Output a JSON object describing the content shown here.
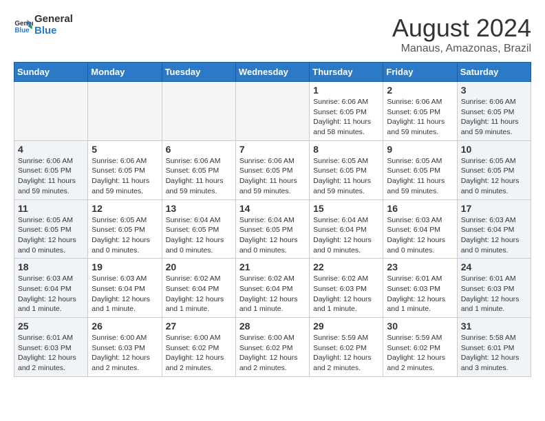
{
  "header": {
    "logo_line1": "General",
    "logo_line2": "Blue",
    "month_year": "August 2024",
    "location": "Manaus, Amazonas, Brazil"
  },
  "weekdays": [
    "Sunday",
    "Monday",
    "Tuesday",
    "Wednesday",
    "Thursday",
    "Friday",
    "Saturday"
  ],
  "weeks": [
    [
      {
        "day": "",
        "info": "",
        "empty": true
      },
      {
        "day": "",
        "info": "",
        "empty": true
      },
      {
        "day": "",
        "info": "",
        "empty": true
      },
      {
        "day": "",
        "info": "",
        "empty": true
      },
      {
        "day": "1",
        "info": "Sunrise: 6:06 AM\nSunset: 6:05 PM\nDaylight: 11 hours\nand 58 minutes.",
        "empty": false
      },
      {
        "day": "2",
        "info": "Sunrise: 6:06 AM\nSunset: 6:05 PM\nDaylight: 11 hours\nand 59 minutes.",
        "empty": false
      },
      {
        "day": "3",
        "info": "Sunrise: 6:06 AM\nSunset: 6:05 PM\nDaylight: 11 hours\nand 59 minutes.",
        "empty": false
      }
    ],
    [
      {
        "day": "4",
        "info": "Sunrise: 6:06 AM\nSunset: 6:05 PM\nDaylight: 11 hours\nand 59 minutes.",
        "empty": false
      },
      {
        "day": "5",
        "info": "Sunrise: 6:06 AM\nSunset: 6:05 PM\nDaylight: 11 hours\nand 59 minutes.",
        "empty": false
      },
      {
        "day": "6",
        "info": "Sunrise: 6:06 AM\nSunset: 6:05 PM\nDaylight: 11 hours\nand 59 minutes.",
        "empty": false
      },
      {
        "day": "7",
        "info": "Sunrise: 6:06 AM\nSunset: 6:05 PM\nDaylight: 11 hours\nand 59 minutes.",
        "empty": false
      },
      {
        "day": "8",
        "info": "Sunrise: 6:05 AM\nSunset: 6:05 PM\nDaylight: 11 hours\nand 59 minutes.",
        "empty": false
      },
      {
        "day": "9",
        "info": "Sunrise: 6:05 AM\nSunset: 6:05 PM\nDaylight: 11 hours\nand 59 minutes.",
        "empty": false
      },
      {
        "day": "10",
        "info": "Sunrise: 6:05 AM\nSunset: 6:05 PM\nDaylight: 12 hours\nand 0 minutes.",
        "empty": false
      }
    ],
    [
      {
        "day": "11",
        "info": "Sunrise: 6:05 AM\nSunset: 6:05 PM\nDaylight: 12 hours\nand 0 minutes.",
        "empty": false
      },
      {
        "day": "12",
        "info": "Sunrise: 6:05 AM\nSunset: 6:05 PM\nDaylight: 12 hours\nand 0 minutes.",
        "empty": false
      },
      {
        "day": "13",
        "info": "Sunrise: 6:04 AM\nSunset: 6:05 PM\nDaylight: 12 hours\nand 0 minutes.",
        "empty": false
      },
      {
        "day": "14",
        "info": "Sunrise: 6:04 AM\nSunset: 6:05 PM\nDaylight: 12 hours\nand 0 minutes.",
        "empty": false
      },
      {
        "day": "15",
        "info": "Sunrise: 6:04 AM\nSunset: 6:04 PM\nDaylight: 12 hours\nand 0 minutes.",
        "empty": false
      },
      {
        "day": "16",
        "info": "Sunrise: 6:03 AM\nSunset: 6:04 PM\nDaylight: 12 hours\nand 0 minutes.",
        "empty": false
      },
      {
        "day": "17",
        "info": "Sunrise: 6:03 AM\nSunset: 6:04 PM\nDaylight: 12 hours\nand 0 minutes.",
        "empty": false
      }
    ],
    [
      {
        "day": "18",
        "info": "Sunrise: 6:03 AM\nSunset: 6:04 PM\nDaylight: 12 hours\nand 1 minute.",
        "empty": false
      },
      {
        "day": "19",
        "info": "Sunrise: 6:03 AM\nSunset: 6:04 PM\nDaylight: 12 hours\nand 1 minute.",
        "empty": false
      },
      {
        "day": "20",
        "info": "Sunrise: 6:02 AM\nSunset: 6:04 PM\nDaylight: 12 hours\nand 1 minute.",
        "empty": false
      },
      {
        "day": "21",
        "info": "Sunrise: 6:02 AM\nSunset: 6:04 PM\nDaylight: 12 hours\nand 1 minute.",
        "empty": false
      },
      {
        "day": "22",
        "info": "Sunrise: 6:02 AM\nSunset: 6:03 PM\nDaylight: 12 hours\nand 1 minute.",
        "empty": false
      },
      {
        "day": "23",
        "info": "Sunrise: 6:01 AM\nSunset: 6:03 PM\nDaylight: 12 hours\nand 1 minute.",
        "empty": false
      },
      {
        "day": "24",
        "info": "Sunrise: 6:01 AM\nSunset: 6:03 PM\nDaylight: 12 hours\nand 1 minute.",
        "empty": false
      }
    ],
    [
      {
        "day": "25",
        "info": "Sunrise: 6:01 AM\nSunset: 6:03 PM\nDaylight: 12 hours\nand 2 minutes.",
        "empty": false
      },
      {
        "day": "26",
        "info": "Sunrise: 6:00 AM\nSunset: 6:03 PM\nDaylight: 12 hours\nand 2 minutes.",
        "empty": false
      },
      {
        "day": "27",
        "info": "Sunrise: 6:00 AM\nSunset: 6:02 PM\nDaylight: 12 hours\nand 2 minutes.",
        "empty": false
      },
      {
        "day": "28",
        "info": "Sunrise: 6:00 AM\nSunset: 6:02 PM\nDaylight: 12 hours\nand 2 minutes.",
        "empty": false
      },
      {
        "day": "29",
        "info": "Sunrise: 5:59 AM\nSunset: 6:02 PM\nDaylight: 12 hours\nand 2 minutes.",
        "empty": false
      },
      {
        "day": "30",
        "info": "Sunrise: 5:59 AM\nSunset: 6:02 PM\nDaylight: 12 hours\nand 2 minutes.",
        "empty": false
      },
      {
        "day": "31",
        "info": "Sunrise: 5:58 AM\nSunset: 6:01 PM\nDaylight: 12 hours\nand 3 minutes.",
        "empty": false
      }
    ]
  ]
}
